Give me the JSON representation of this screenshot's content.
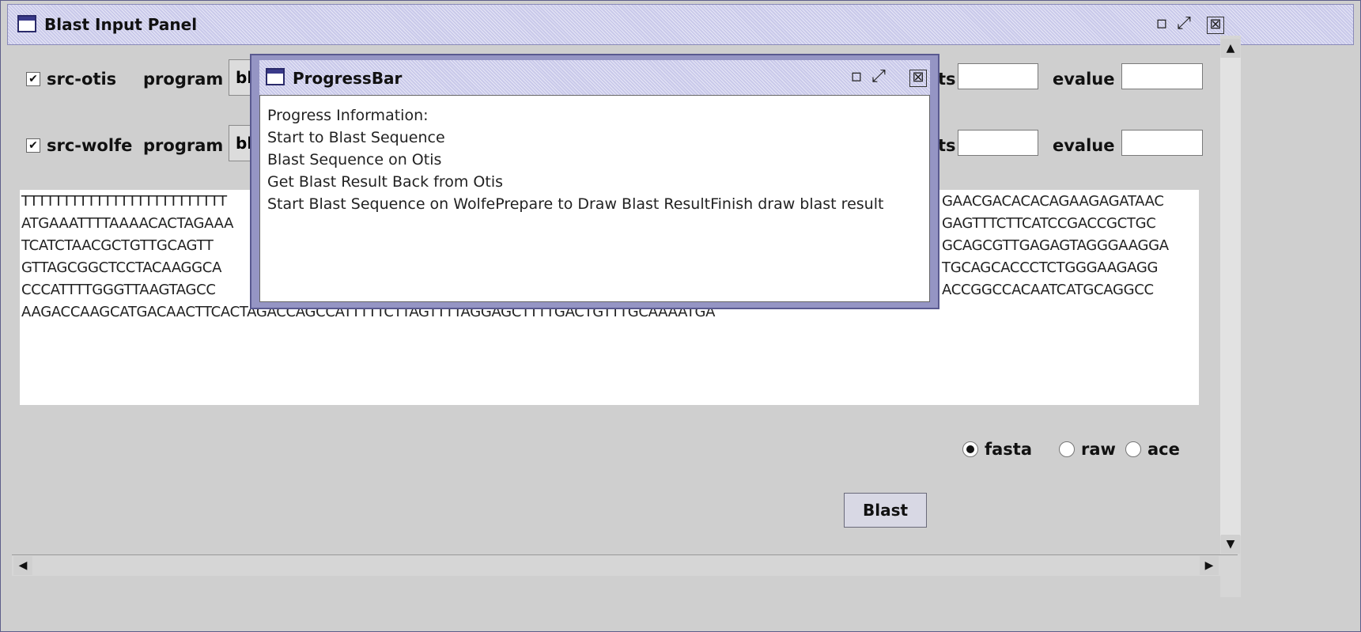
{
  "main_window": {
    "title": "Blast Input Panel",
    "controls": {
      "minimize": "▫",
      "maximize": "⤢",
      "close": "⊠"
    }
  },
  "sources": [
    {
      "checked": "✔",
      "name": "src-otis",
      "program_label": "program",
      "program_value": "bl",
      "hits_label": "ts",
      "evalue_label": "evalue"
    },
    {
      "checked": "✔",
      "name": "src-wolfe",
      "program_label": "program",
      "program_value": "bl",
      "hits_label": "ts",
      "evalue_label": "evalue"
    }
  ],
  "sequence": {
    "left": [
      "TTTTTTTTTTTTTTTTTTTTTTTTT",
      "ATGAAATTTTAAAACACTAGAAA",
      "TCATCTAACGCTGTTGCAGTT",
      "GTTAGCGGCTCCTACAAGGCA",
      "CCCATTTTGGGTTAAGTAGCC",
      "AAGACCAAGCATGACAACTTCACTAGACCAGCCATTTTTCTTAGTTTTAGGAGCTTTTGACTGTTTGCAAAATGA"
    ],
    "right": [
      "GAACGACACACAGAAGAGATAAC",
      "GAGTTTCTTCATCCGACCGCTGC",
      "GCAGCGTTGAGAGTAGGGAAGGA",
      "TGCAGCACCCTCTGGGAAGAGG",
      "ACCGGCCACAATCATGCAGGCC"
    ]
  },
  "formats": [
    {
      "label": "fasta",
      "selected": true
    },
    {
      "label": "raw",
      "selected": false
    },
    {
      "label": "ace",
      "selected": false
    }
  ],
  "blast_button": "Blast",
  "scroll": {
    "up": "▲",
    "down": "▼",
    "left": "◀",
    "right": "▶"
  },
  "progress_window": {
    "title": "ProgressBar",
    "lines": [
      "Progress Information:",
      "Start to Blast Sequence",
      "Blast Sequence on Otis",
      "Get Blast Result Back from Otis",
      "Start Blast Sequence on WolfePrepare to Draw Blast ResultFinish draw blast result"
    ]
  }
}
